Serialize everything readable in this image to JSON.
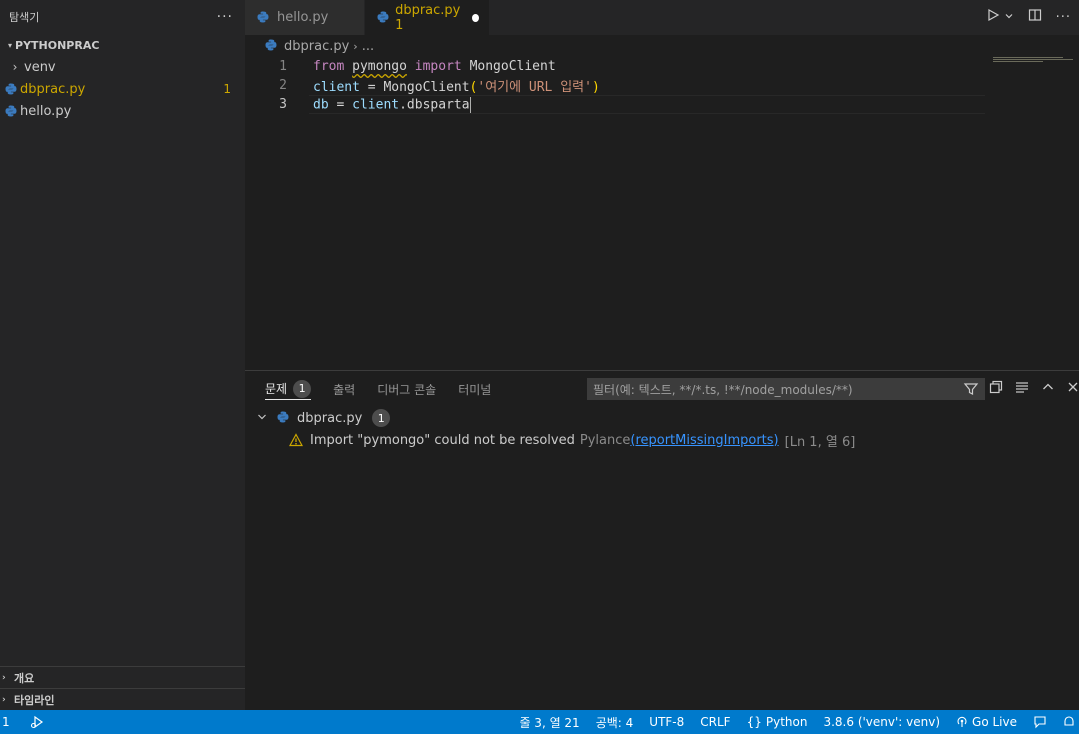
{
  "sidebar": {
    "title": "탐색기",
    "more": "···",
    "project": "PYTHONPRAC",
    "items": [
      {
        "label": "venv",
        "type": "folder"
      },
      {
        "label": "dbprac.py",
        "type": "file",
        "count": "1"
      },
      {
        "label": "hello.py",
        "type": "file"
      }
    ],
    "outline": "개요",
    "timeline": "타임라인"
  },
  "tabs": [
    {
      "label": "hello.py"
    },
    {
      "label": "dbprac.py 1"
    }
  ],
  "breadcrumb": {
    "file": "dbprac.py",
    "rest": "..."
  },
  "editor": {
    "line_numbers": [
      "1",
      "2",
      "3"
    ],
    "line1": {
      "kw1": "from",
      "module": "pymongo",
      "kw2": "import",
      "name": "MongoClient"
    },
    "line2": {
      "var": "client",
      "op": " = ",
      "cls": "MongoClient",
      "open": "(",
      "str": "'여기에 URL 입력'",
      "close": ")"
    },
    "line3": {
      "var": "db",
      "op": " = ",
      "obj": "client",
      "attr": ".dbsparta"
    }
  },
  "panel": {
    "tabs": [
      {
        "label": "문제",
        "badge": "1"
      },
      {
        "label": "출력"
      },
      {
        "label": "디버그 콘솔"
      },
      {
        "label": "터미널"
      }
    ],
    "filter_placeholder": "필터(예: 텍스트, **/*.ts, !**/node_modules/**)",
    "problem_file": {
      "name": "dbprac.py",
      "badge": "1"
    },
    "problem": {
      "message": "Import \"pymongo\" could not be resolved",
      "source": "Pylance",
      "code_open": "(",
      "code": "reportMissingImports",
      "code_close": ")",
      "location": "[Ln 1, 열 6]"
    }
  },
  "statusbar": {
    "left_count": "1",
    "position": "줄 3, 열 21",
    "spaces": "공백: 4",
    "encoding": "UTF-8",
    "eol": "CRLF",
    "language": "Python",
    "interpreter": "3.8.6 ('venv': venv)",
    "live": "Go Live"
  },
  "colors": {
    "accent": "#007acc",
    "warning": "#cca700",
    "link": "#3794ff"
  }
}
